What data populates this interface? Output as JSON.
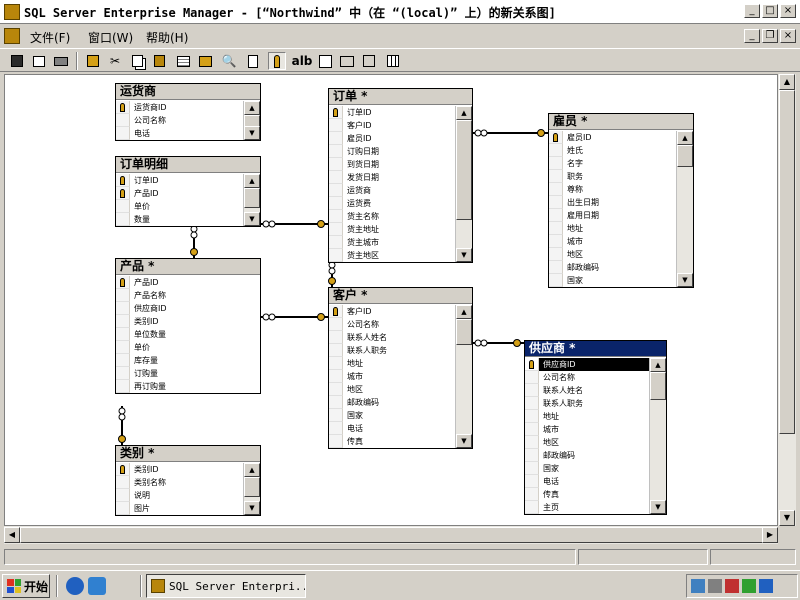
{
  "window": {
    "title": "SQL Server Enterprise Manager - [“Northwind” 中（在 “(local)” 上）的新关系图]"
  },
  "menu": [
    {
      "label": "文件(F)"
    },
    {
      "label": "窗口(W)"
    },
    {
      "label": "帮助(H)"
    }
  ],
  "toolbar": {
    "text_button": "alb"
  },
  "tables": [
    {
      "title": "运货商",
      "columns": [
        "运货商ID",
        "公司名称",
        "电话"
      ],
      "keys": [
        0
      ]
    },
    {
      "title": "订单明细",
      "columns": [
        "订单ID",
        "产品ID",
        "单价",
        "数量"
      ],
      "keys": [
        0,
        1
      ]
    },
    {
      "title": "产品 *",
      "columns": [
        "产品ID",
        "产品名称",
        "供应商ID",
        "类别ID",
        "单位数量",
        "单价",
        "库存量",
        "订购量",
        "再订购量"
      ],
      "keys": [
        0
      ]
    },
    {
      "title": "类别 *",
      "columns": [
        "类别ID",
        "类别名称",
        "说明",
        "图片"
      ],
      "keys": [
        0
      ]
    },
    {
      "title": "订单 *",
      "columns": [
        "订单ID",
        "客户ID",
        "雇员ID",
        "订购日期",
        "到货日期",
        "发货日期",
        "运货商",
        "运货费",
        "货主名称",
        "货主地址",
        "货主城市",
        "货主地区"
      ],
      "keys": [
        0
      ]
    },
    {
      "title": "客户 *",
      "columns": [
        "客户ID",
        "公司名称",
        "联系人姓名",
        "联系人职务",
        "地址",
        "城市",
        "地区",
        "邮政编码",
        "国家",
        "电话",
        "传真"
      ],
      "keys": [
        0
      ]
    },
    {
      "title": "雇员 *",
      "columns": [
        "雇员ID",
        "姓氏",
        "名字",
        "职务",
        "尊称",
        "出生日期",
        "雇用日期",
        "地址",
        "城市",
        "地区",
        "邮政编码",
        "国家"
      ],
      "keys": [
        0
      ]
    },
    {
      "title": "供应商 *",
      "columns": [
        "供应商ID",
        "公司名称",
        "联系人姓名",
        "联系人职务",
        "地址",
        "城市",
        "地区",
        "邮政编码",
        "国家",
        "电话",
        "传真",
        "主页"
      ],
      "keys": [
        0
      ],
      "selected": true
    }
  ],
  "taskbar": {
    "start_label": "开始",
    "task_label": "SQL Server Enterpri..."
  },
  "icons": {
    "key": "key-icon",
    "app": "enterprise-manager-icon"
  },
  "colors": {
    "selected_header": "#0a246a",
    "relationship_line": "#000000",
    "key_end": "#d4a017"
  }
}
